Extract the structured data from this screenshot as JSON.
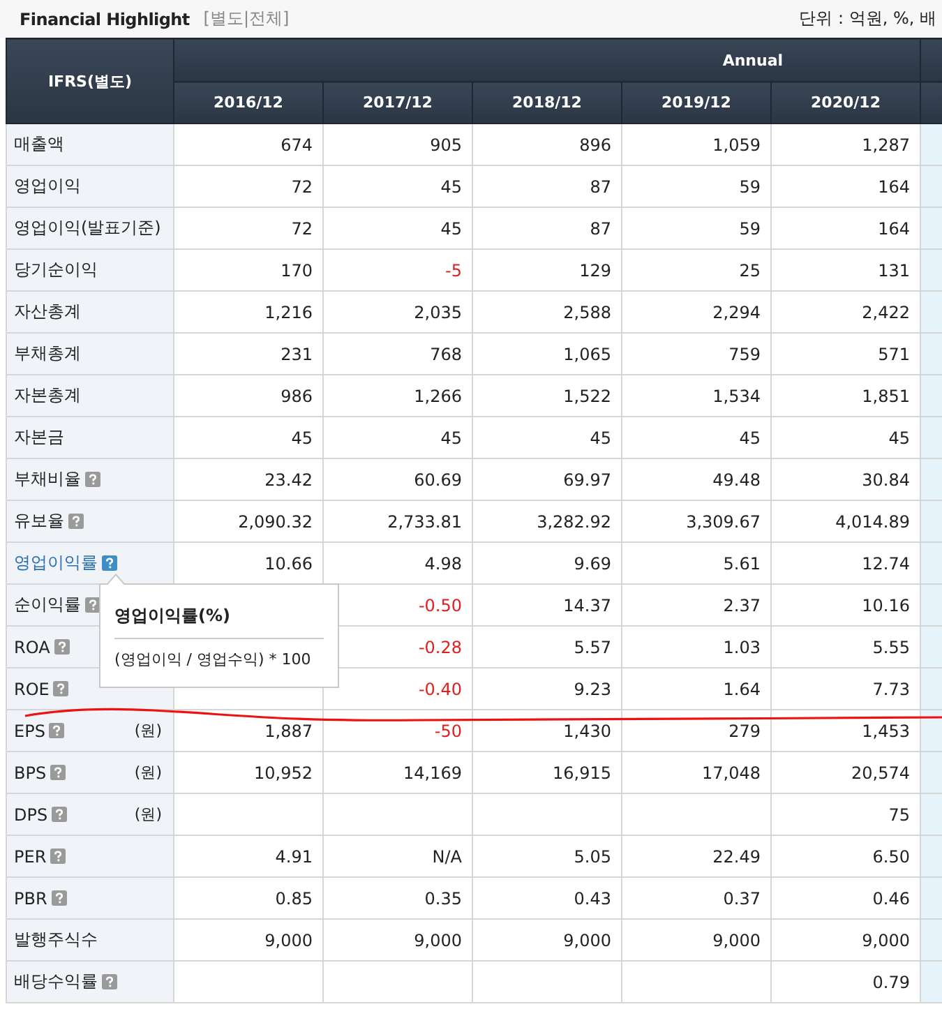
{
  "title": "Financial Highlight",
  "view_toggle": "[별도|전체]",
  "unit_note": "단위 : 억원, %, 배",
  "table": {
    "corner": "IFRS(별도)",
    "group": "Annual",
    "columns": [
      "2016/12",
      "2017/12",
      "2018/12",
      "2019/12",
      "2020/12"
    ],
    "rows": [
      {
        "label": "매출액",
        "kind": "plain",
        "active": false,
        "values": [
          "674",
          "905",
          "896",
          "1,059",
          "1,287"
        ]
      },
      {
        "label": "영업이익",
        "kind": "plain",
        "active": false,
        "values": [
          "72",
          "45",
          "87",
          "59",
          "164"
        ]
      },
      {
        "label": "영업이익(발표기준)",
        "kind": "plain",
        "active": false,
        "values": [
          "72",
          "45",
          "87",
          "59",
          "164"
        ]
      },
      {
        "label": "당기순이익",
        "kind": "plain",
        "active": false,
        "values": [
          "170",
          "-5",
          "129",
          "25",
          "131"
        ]
      },
      {
        "label": "자산총계",
        "kind": "plain",
        "active": false,
        "values": [
          "1,216",
          "2,035",
          "2,588",
          "2,294",
          "2,422"
        ]
      },
      {
        "label": "부채총계",
        "kind": "plain",
        "active": false,
        "values": [
          "231",
          "768",
          "1,065",
          "759",
          "571"
        ]
      },
      {
        "label": "자본총계",
        "kind": "plain",
        "active": false,
        "values": [
          "986",
          "1,266",
          "1,522",
          "1,534",
          "1,851"
        ]
      },
      {
        "label": "자본금",
        "kind": "plain",
        "active": false,
        "values": [
          "45",
          "45",
          "45",
          "45",
          "45"
        ]
      },
      {
        "label": "부채비율",
        "kind": "help",
        "active": false,
        "values": [
          "23.42",
          "60.69",
          "69.97",
          "49.48",
          "30.84"
        ]
      },
      {
        "label": "유보율",
        "kind": "help",
        "active": false,
        "values": [
          "2,090.32",
          "2,733.81",
          "3,282.92",
          "3,309.67",
          "4,014.89"
        ]
      },
      {
        "label": "영업이익률",
        "kind": "help",
        "active": true,
        "values": [
          "10.66",
          "4.98",
          "9.69",
          "5.61",
          "12.74"
        ],
        "tooltip": {
          "title": "영업이익률(%)",
          "formula": "(영업이익 / 영업수익) * 100"
        }
      },
      {
        "label": "순이익률",
        "kind": "help",
        "active": false,
        "values": [
          "-0.50",
          "14.37",
          "2.37",
          "10.16"
        ]
      },
      {
        "label": "ROA",
        "kind": "help",
        "active": false,
        "values": [
          "-0.28",
          "5.57",
          "1.03",
          "5.55"
        ]
      },
      {
        "label": "ROE",
        "kind": "help",
        "active": false,
        "values": [
          "-0.40",
          "9.23",
          "1.64",
          "7.73"
        ]
      },
      {
        "label": "EPS",
        "kind": "help",
        "active": false,
        "unit": "(원)",
        "values": [
          "1,887",
          "-50",
          "1,430",
          "279",
          "1,453"
        ]
      },
      {
        "label": "BPS",
        "kind": "help",
        "active": false,
        "unit": "(원)",
        "values": [
          "10,952",
          "14,169",
          "16,915",
          "17,048",
          "20,574"
        ]
      },
      {
        "label": "DPS",
        "kind": "help",
        "active": false,
        "unit": "(원)",
        "values": [
          "75"
        ]
      },
      {
        "label": "PER",
        "kind": "help",
        "active": false,
        "values": [
          "4.91",
          "N/A",
          "5.05",
          "22.49",
          "6.50"
        ]
      },
      {
        "label": "PBR",
        "kind": "help",
        "active": false,
        "values": [
          "0.85",
          "0.35",
          "0.43",
          "0.37",
          "0.46"
        ]
      },
      {
        "label": "발행주식수",
        "kind": "plain",
        "active": false,
        "values": [
          "9,000",
          "9,000",
          "9,000",
          "9,000",
          "9,000"
        ]
      },
      {
        "label": "배당수익률",
        "kind": "help",
        "active": false,
        "values": [
          "0.79"
        ]
      }
    ]
  }
}
